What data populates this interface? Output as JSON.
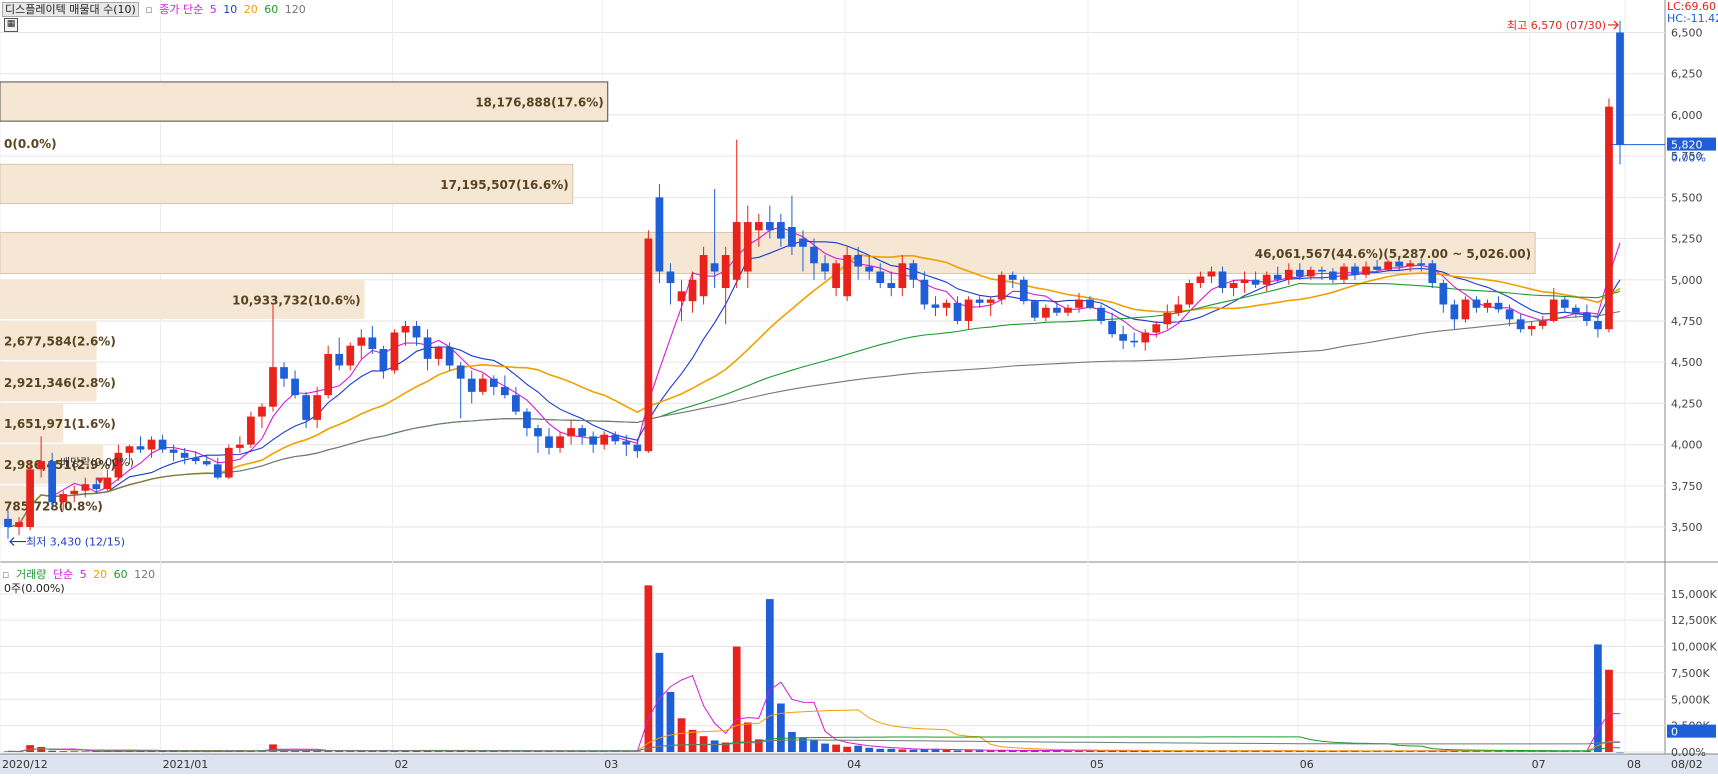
{
  "price_panel": {
    "indicator_label": "디스플레이텍 매물대 수(10)",
    "ma_title": "종가 단순",
    "ma_periods": [
      "5",
      "10",
      "20",
      "60",
      "120"
    ],
    "ma_colors": [
      "#d81bd8",
      "#1a3bd1",
      "#f0a000",
      "#1a9a30",
      "#777777"
    ],
    "lc_label": "LC:69.60",
    "hc_label": "HC:-11.42",
    "high_label": "최고 6,570 (07/30)",
    "low_label": "최저 3,430 (12/15)",
    "dividend_label": "배당락(0.00%)",
    "current_price_tag": "5,820",
    "current_pct_tag": "0.00%",
    "y_ticks": [
      "6,500",
      "6,250",
      "6,000",
      "5,750",
      "5,500",
      "5,250",
      "5,000",
      "4,750",
      "4,500",
      "4,250",
      "4,000",
      "3,750",
      "3,500"
    ],
    "volume_profile": [
      {
        "label": "18,176,888(17.6%)",
        "from": 5950,
        "to": 6200,
        "width": 0.365
      },
      {
        "label": "0(0.0%)",
        "from": 5700,
        "to": 5950,
        "width": 0
      },
      {
        "label": "17,195,507(16.6%)",
        "from": 5450,
        "to": 5700,
        "width": 0.344
      },
      {
        "label": "46,061,567(44.6%)(5,287.00 ~ 5,026.00)",
        "from": 5026,
        "to": 5287,
        "width": 0.922
      },
      {
        "label": "10,933,732(10.6%)",
        "from": 4750,
        "to": 5000,
        "width": 0.219
      },
      {
        "label": "2,677,584(2.6%)",
        "from": 4500,
        "to": 4750,
        "width": 0.058
      },
      {
        "label": "2,921,346(2.8%)",
        "from": 4250,
        "to": 4500,
        "width": 0.058
      },
      {
        "label": "1,651,971(1.6%)",
        "from": 4000,
        "to": 4250,
        "width": 0.038
      },
      {
        "label": "2,986,451(2.9%)",
        "from": 3750,
        "to": 4000,
        "width": 0.062
      },
      {
        "label": "785,728(0.8%)",
        "from": 3500,
        "to": 3750,
        "width": 0.017
      }
    ]
  },
  "volume_panel": {
    "title": "거래량",
    "ma_title": "단순",
    "ma_periods": [
      "5",
      "20",
      "60",
      "120"
    ],
    "ma_colors": [
      "#d81bd8",
      "#f0a000",
      "#1a9a30",
      "#777777"
    ],
    "info_label": "0주(0.00%)",
    "y_ticks": [
      "15,000K",
      "12,500K",
      "10,000K",
      "7,500K",
      "5,000K",
      "2,500K",
      "0.00%"
    ],
    "current_tag": "0"
  },
  "x_axis": {
    "labels": [
      "2020/12",
      "2021/01",
      "02",
      "03",
      "04",
      "05",
      "06",
      "07",
      "08",
      "08/02"
    ]
  },
  "chart_data": {
    "type": "candlestick",
    "symbol": "디스플레이텍",
    "y_unit": "KRW",
    "ylim": [
      3300,
      6600
    ],
    "volume_ylim": [
      0,
      16500
    ],
    "volume_unit": "K shares",
    "candles": [
      {
        "open": 3550,
        "high": 3600,
        "low": 3430,
        "close": 3500
      },
      {
        "open": 3500,
        "high": 3560,
        "low": 3450,
        "close": 3530
      },
      {
        "open": 3500,
        "high": 3900,
        "low": 3480,
        "close": 3850
      },
      {
        "open": 3850,
        "high": 4050,
        "low": 3800,
        "close": 3900
      },
      {
        "open": 3900,
        "high": 3950,
        "low": 3620,
        "close": 3650
      },
      {
        "open": 3650,
        "high": 3720,
        "low": 3600,
        "close": 3700
      },
      {
        "open": 3700,
        "high": 3750,
        "low": 3650,
        "close": 3720
      },
      {
        "open": 3720,
        "high": 3800,
        "low": 3680,
        "close": 3760
      },
      {
        "open": 3760,
        "high": 3800,
        "low": 3700,
        "close": 3730
      },
      {
        "open": 3730,
        "high": 3850,
        "low": 3720,
        "close": 3800
      },
      {
        "open": 3800,
        "high": 4000,
        "low": 3780,
        "close": 3950
      },
      {
        "open": 3950,
        "high": 4000,
        "low": 3880,
        "close": 3990
      },
      {
        "open": 3990,
        "high": 4050,
        "low": 3950,
        "close": 3970
      },
      {
        "open": 3970,
        "high": 4050,
        "low": 3920,
        "close": 4030
      },
      {
        "open": 4030,
        "high": 4060,
        "low": 3950,
        "close": 3970
      },
      {
        "open": 3970,
        "high": 4000,
        "low": 3900,
        "close": 3950
      },
      {
        "open": 3950,
        "high": 3980,
        "low": 3880,
        "close": 3920
      },
      {
        "open": 3920,
        "high": 3960,
        "low": 3880,
        "close": 3900
      },
      {
        "open": 3900,
        "high": 3940,
        "low": 3870,
        "close": 3880
      },
      {
        "open": 3880,
        "high": 3920,
        "low": 3790,
        "close": 3800
      },
      {
        "open": 3800,
        "high": 4000,
        "low": 3790,
        "close": 3980
      },
      {
        "open": 3980,
        "high": 4050,
        "low": 3950,
        "close": 4000
      },
      {
        "open": 4000,
        "high": 4200,
        "low": 3980,
        "close": 4170
      },
      {
        "open": 4170,
        "high": 4250,
        "low": 4100,
        "close": 4230
      },
      {
        "open": 4230,
        "high": 4850,
        "low": 4200,
        "close": 4470
      },
      {
        "open": 4470,
        "high": 4500,
        "low": 4350,
        "close": 4400
      },
      {
        "open": 4400,
        "high": 4450,
        "low": 4280,
        "close": 4300
      },
      {
        "open": 4300,
        "high": 4320,
        "low": 4100,
        "close": 4150
      },
      {
        "open": 4150,
        "high": 4350,
        "low": 4100,
        "close": 4300
      },
      {
        "open": 4300,
        "high": 4600,
        "low": 4280,
        "close": 4550
      },
      {
        "open": 4550,
        "high": 4650,
        "low": 4450,
        "close": 4480
      },
      {
        "open": 4480,
        "high": 4620,
        "low": 4450,
        "close": 4600
      },
      {
        "open": 4600,
        "high": 4700,
        "low": 4520,
        "close": 4650
      },
      {
        "open": 4650,
        "high": 4720,
        "low": 4550,
        "close": 4580
      },
      {
        "open": 4580,
        "high": 4600,
        "low": 4400,
        "close": 4450
      },
      {
        "open": 4450,
        "high": 4700,
        "low": 4430,
        "close": 4680
      },
      {
        "open": 4680,
        "high": 4750,
        "low": 4600,
        "close": 4720
      },
      {
        "open": 4720,
        "high": 4750,
        "low": 4600,
        "close": 4650
      },
      {
        "open": 4650,
        "high": 4700,
        "low": 4450,
        "close": 4520
      },
      {
        "open": 4520,
        "high": 4600,
        "low": 4480,
        "close": 4590
      },
      {
        "open": 4590,
        "high": 4620,
        "low": 4450,
        "close": 4480
      },
      {
        "open": 4480,
        "high": 4500,
        "low": 4160,
        "close": 4400
      },
      {
        "open": 4400,
        "high": 4450,
        "low": 4250,
        "close": 4320
      },
      {
        "open": 4320,
        "high": 4430,
        "low": 4300,
        "close": 4400
      },
      {
        "open": 4400,
        "high": 4420,
        "low": 4300,
        "close": 4350
      },
      {
        "open": 4350,
        "high": 4420,
        "low": 4280,
        "close": 4300
      },
      {
        "open": 4300,
        "high": 4350,
        "low": 4180,
        "close": 4200
      },
      {
        "open": 4200,
        "high": 4220,
        "low": 4050,
        "close": 4100
      },
      {
        "open": 4100,
        "high": 4120,
        "low": 3950,
        "close": 4050
      },
      {
        "open": 4050,
        "high": 4100,
        "low": 3940,
        "close": 3980
      },
      {
        "open": 3980,
        "high": 4080,
        "low": 3950,
        "close": 4050
      },
      {
        "open": 4050,
        "high": 4150,
        "low": 4000,
        "close": 4100
      },
      {
        "open": 4100,
        "high": 4120,
        "low": 4000,
        "close": 4050
      },
      {
        "open": 4050,
        "high": 4080,
        "low": 3950,
        "close": 4000
      },
      {
        "open": 4000,
        "high": 4080,
        "low": 3970,
        "close": 4060
      },
      {
        "open": 4060,
        "high": 4080,
        "low": 4000,
        "close": 4020
      },
      {
        "open": 4020,
        "high": 4060,
        "low": 3930,
        "close": 4000
      },
      {
        "open": 4000,
        "high": 4030,
        "low": 3920,
        "close": 3960
      },
      {
        "open": 3960,
        "high": 5300,
        "low": 3950,
        "close": 5250
      },
      {
        "open": 5500,
        "high": 5580,
        "low": 4980,
        "close": 5050
      },
      {
        "open": 5050,
        "high": 5100,
        "low": 4850,
        "close": 4980
      },
      {
        "open": 4870,
        "high": 5000,
        "low": 4750,
        "close": 4930
      },
      {
        "open": 4870,
        "high": 5050,
        "low": 4800,
        "close": 5000
      },
      {
        "open": 4900,
        "high": 5200,
        "low": 4850,
        "close": 5150
      },
      {
        "open": 5100,
        "high": 5550,
        "low": 4950,
        "close": 5050
      },
      {
        "open": 4950,
        "high": 5200,
        "low": 4730,
        "close": 5150
      },
      {
        "open": 5000,
        "high": 5850,
        "low": 4950,
        "close": 5350
      },
      {
        "open": 5050,
        "high": 5450,
        "low": 4950,
        "close": 5350
      },
      {
        "open": 5300,
        "high": 5400,
        "low": 5200,
        "close": 5350
      },
      {
        "open": 5350,
        "high": 5450,
        "low": 5250,
        "close": 5300
      },
      {
        "open": 5350,
        "high": 5400,
        "low": 5200,
        "close": 5250
      },
      {
        "open": 5320,
        "high": 5510,
        "low": 5150,
        "close": 5200
      },
      {
        "open": 5250,
        "high": 5300,
        "low": 5050,
        "close": 5200
      },
      {
        "open": 5200,
        "high": 5250,
        "low": 5000,
        "close": 5100
      },
      {
        "open": 5100,
        "high": 5150,
        "low": 5000,
        "close": 5050
      },
      {
        "open": 4950,
        "high": 5120,
        "low": 4900,
        "close": 5100
      },
      {
        "open": 4900,
        "high": 5200,
        "low": 4870,
        "close": 5150
      },
      {
        "open": 5150,
        "high": 5200,
        "low": 5000,
        "close": 5080
      },
      {
        "open": 5080,
        "high": 5150,
        "low": 5000,
        "close": 5050
      },
      {
        "open": 5050,
        "high": 5100,
        "low": 4950,
        "close": 4980
      },
      {
        "open": 4980,
        "high": 5050,
        "low": 4900,
        "close": 4950
      },
      {
        "open": 4950,
        "high": 5150,
        "low": 4900,
        "close": 5100
      },
      {
        "open": 5100,
        "high": 5120,
        "low": 4950,
        "close": 5000
      },
      {
        "open": 5000,
        "high": 5050,
        "low": 4820,
        "close": 4850
      },
      {
        "open": 4850,
        "high": 4900,
        "low": 4780,
        "close": 4830
      },
      {
        "open": 4830,
        "high": 4880,
        "low": 4780,
        "close": 4860
      },
      {
        "open": 4860,
        "high": 4900,
        "low": 4730,
        "close": 4750
      },
      {
        "open": 4750,
        "high": 4900,
        "low": 4700,
        "close": 4880
      },
      {
        "open": 4880,
        "high": 4900,
        "low": 4830,
        "close": 4860
      },
      {
        "open": 4860,
        "high": 4900,
        "low": 4780,
        "close": 4880
      },
      {
        "open": 4880,
        "high": 5050,
        "low": 4850,
        "close": 5030
      },
      {
        "open": 5030,
        "high": 5050,
        "low": 4950,
        "close": 5000
      },
      {
        "open": 5000,
        "high": 5020,
        "low": 4850,
        "close": 4870
      },
      {
        "open": 4870,
        "high": 4880,
        "low": 4750,
        "close": 4770
      },
      {
        "open": 4770,
        "high": 4850,
        "low": 4750,
        "close": 4830
      },
      {
        "open": 4830,
        "high": 4870,
        "low": 4780,
        "close": 4800
      },
      {
        "open": 4800,
        "high": 4850,
        "low": 4780,
        "close": 4830
      },
      {
        "open": 4830,
        "high": 4920,
        "low": 4800,
        "close": 4880
      },
      {
        "open": 4880,
        "high": 4900,
        "low": 4820,
        "close": 4830
      },
      {
        "open": 4830,
        "high": 4850,
        "low": 4730,
        "close": 4750
      },
      {
        "open": 4750,
        "high": 4800,
        "low": 4650,
        "close": 4670
      },
      {
        "open": 4670,
        "high": 4720,
        "low": 4580,
        "close": 4630
      },
      {
        "open": 4630,
        "high": 4680,
        "low": 4590,
        "close": 4620
      },
      {
        "open": 4620,
        "high": 4700,
        "low": 4570,
        "close": 4680
      },
      {
        "open": 4680,
        "high": 4750,
        "low": 4650,
        "close": 4730
      },
      {
        "open": 4730,
        "high": 4850,
        "low": 4700,
        "close": 4800
      },
      {
        "open": 4800,
        "high": 4900,
        "low": 4780,
        "close": 4850
      },
      {
        "open": 4850,
        "high": 5000,
        "low": 4830,
        "close": 4980
      },
      {
        "open": 4980,
        "high": 5050,
        "low": 4950,
        "close": 5020
      },
      {
        "open": 5020,
        "high": 5080,
        "low": 4980,
        "close": 5050
      },
      {
        "open": 5050,
        "high": 5080,
        "low": 4920,
        "close": 4950
      },
      {
        "open": 4950,
        "high": 5000,
        "low": 4900,
        "close": 4980
      },
      {
        "open": 4980,
        "high": 5050,
        "low": 4920,
        "close": 5000
      },
      {
        "open": 5000,
        "high": 5050,
        "low": 4950,
        "close": 4970
      },
      {
        "open": 4970,
        "high": 5050,
        "low": 4930,
        "close": 5030
      },
      {
        "open": 5030,
        "high": 5080,
        "low": 4980,
        "close": 5000
      },
      {
        "open": 5000,
        "high": 5100,
        "low": 4970,
        "close": 5060
      },
      {
        "open": 5060,
        "high": 5100,
        "low": 5000,
        "close": 5020
      },
      {
        "open": 5020,
        "high": 5080,
        "low": 5000,
        "close": 5060
      },
      {
        "open": 5060,
        "high": 5080,
        "low": 5000,
        "close": 5050
      },
      {
        "open": 5050,
        "high": 5070,
        "low": 4980,
        "close": 5000
      },
      {
        "open": 5000,
        "high": 5100,
        "low": 4980,
        "close": 5080
      },
      {
        "open": 5080,
        "high": 5100,
        "low": 5000,
        "close": 5030
      },
      {
        "open": 5030,
        "high": 5110,
        "low": 5010,
        "close": 5080
      },
      {
        "open": 5080,
        "high": 5120,
        "low": 5040,
        "close": 5060
      },
      {
        "open": 5060,
        "high": 5120,
        "low": 5050,
        "close": 5110
      },
      {
        "open": 5110,
        "high": 5130,
        "low": 5060,
        "close": 5080
      },
      {
        "open": 5080,
        "high": 5120,
        "low": 5050,
        "close": 5100
      },
      {
        "open": 5100,
        "high": 5130,
        "low": 5050,
        "close": 5090
      },
      {
        "open": 5100,
        "high": 5120,
        "low": 4950,
        "close": 4980
      },
      {
        "open": 4980,
        "high": 5000,
        "low": 4800,
        "close": 4850
      },
      {
        "open": 4850,
        "high": 4880,
        "low": 4700,
        "close": 4760
      },
      {
        "open": 4760,
        "high": 4900,
        "low": 4740,
        "close": 4880
      },
      {
        "open": 4880,
        "high": 4900,
        "low": 4800,
        "close": 4830
      },
      {
        "open": 4830,
        "high": 4880,
        "low": 4800,
        "close": 4860
      },
      {
        "open": 4860,
        "high": 4900,
        "low": 4800,
        "close": 4820
      },
      {
        "open": 4820,
        "high": 4850,
        "low": 4720,
        "close": 4760
      },
      {
        "open": 4760,
        "high": 4790,
        "low": 4680,
        "close": 4700
      },
      {
        "open": 4700,
        "high": 4750,
        "low": 4660,
        "close": 4720
      },
      {
        "open": 4720,
        "high": 4780,
        "low": 4700,
        "close": 4750
      },
      {
        "open": 4750,
        "high": 4950,
        "low": 4740,
        "close": 4880
      },
      {
        "open": 4880,
        "high": 4900,
        "low": 4800,
        "close": 4830
      },
      {
        "open": 4830,
        "high": 4850,
        "low": 4770,
        "close": 4800
      },
      {
        "open": 4800,
        "high": 4850,
        "low": 4720,
        "close": 4750
      },
      {
        "open": 4750,
        "high": 4790,
        "low": 4650,
        "close": 4700
      },
      {
        "open": 4700,
        "high": 6100,
        "low": 4680,
        "close": 6050
      },
      {
        "open": 6500,
        "high": 6570,
        "low": 5700,
        "close": 5820
      }
    ],
    "volumes": [
      60,
      40,
      650,
      480,
      120,
      80,
      70,
      60,
      50,
      90,
      120,
      100,
      80,
      70,
      90,
      60,
      50,
      60,
      40,
      80,
      100,
      120,
      140,
      160,
      720,
      200,
      150,
      120,
      100,
      140,
      110,
      90,
      100,
      90,
      110,
      150,
      120,
      90,
      100,
      80,
      110,
      140,
      90,
      80,
      70,
      60,
      90,
      110,
      80,
      70,
      60,
      80,
      70,
      60,
      50,
      60,
      70,
      60,
      15800,
      9400,
      5700,
      3200,
      2100,
      1500,
      1100,
      900,
      10000,
      2800,
      1200,
      14500,
      4600,
      1900,
      1400,
      1100,
      800,
      700,
      500,
      600,
      400,
      300,
      300,
      250,
      220,
      250,
      300,
      200,
      150,
      180,
      160,
      150,
      150,
      140,
      130,
      170,
      140,
      130,
      110,
      150,
      120,
      100,
      100,
      120,
      110,
      130,
      100,
      90,
      110,
      150,
      130,
      120,
      120,
      100,
      120,
      130,
      110,
      100,
      90,
      110,
      100,
      90,
      100,
      110,
      100,
      90,
      100,
      100,
      120,
      110,
      130,
      120,
      140,
      160,
      110,
      90,
      80,
      70,
      60,
      70,
      80,
      90,
      70,
      80,
      100,
      90,
      10200,
      7800,
      0
    ]
  }
}
